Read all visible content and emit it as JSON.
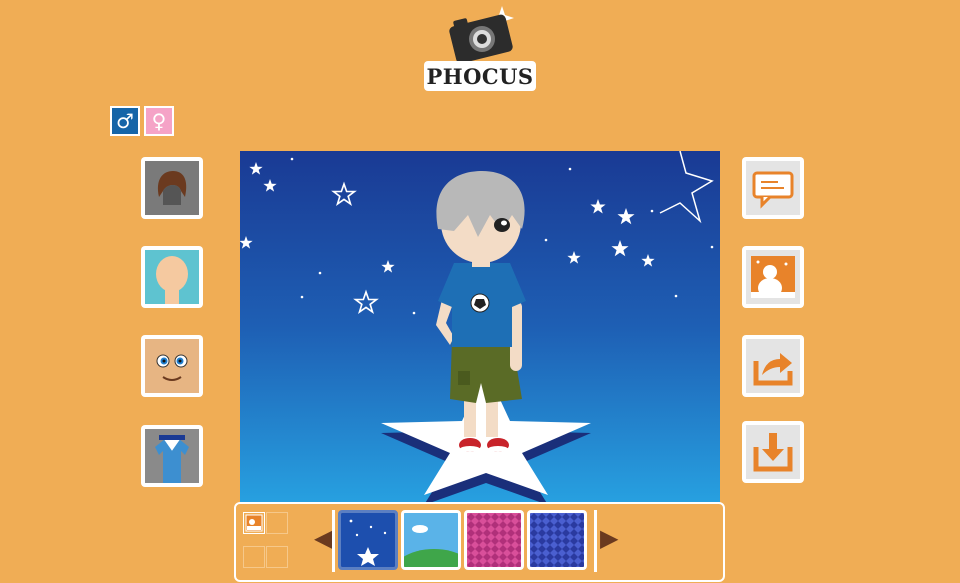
{
  "app": {
    "title": "PHOCUS"
  },
  "gender": {
    "male_symbol": "♂",
    "female_symbol": "♀",
    "male_color": "#1565A8",
    "female_color": "#F5A3C7"
  },
  "left_tools": [
    "hair-icon",
    "skin-icon",
    "face-icon",
    "clothes-icon"
  ],
  "right_tools": [
    "speech-bubble-icon",
    "background-icon",
    "share-icon",
    "download-icon"
  ],
  "background_thumbnails": [
    "starry-night",
    "green-hill",
    "pink-argyle",
    "blue-argyle"
  ],
  "nav": {
    "prev_symbol": "◀",
    "next_symbol": "▶"
  },
  "colors": {
    "page_bg": "#F0AD55",
    "accent_orange": "#E8832A",
    "stage_top": "#1a3a94",
    "stage_bottom": "#27a0e0"
  }
}
